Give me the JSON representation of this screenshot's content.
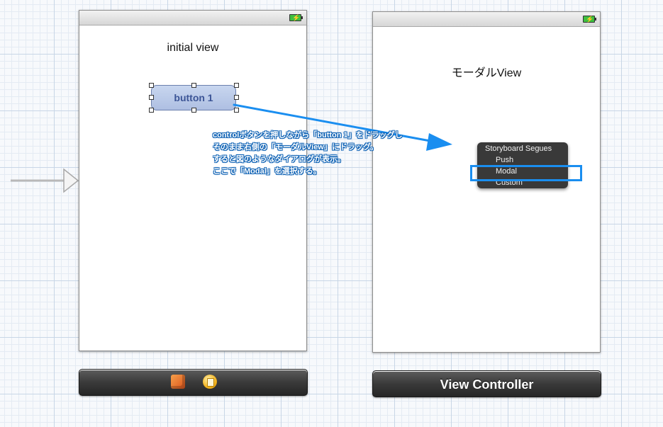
{
  "scenes": {
    "initial": {
      "title": "initial view",
      "button_label": "button 1"
    },
    "modal": {
      "title": "モーダルView"
    }
  },
  "docks": {
    "initial": {
      "icons": [
        "first-responder-cube-icon",
        "view-controller-icon"
      ]
    },
    "modal": {
      "label": "View Controller"
    }
  },
  "annotation": {
    "lines": [
      "controlボタンを押しながら「button 1」をドラッグし",
      "そのまま右側の「モーダルView」にドラッグ。",
      "すると図のようなダイアログが表示。",
      "ここで「Modal」を選択する。"
    ]
  },
  "segue_menu": {
    "header": "Storyboard Segues",
    "items": [
      "Push",
      "Modal",
      "Custom"
    ],
    "highlighted": "Modal"
  },
  "colors": {
    "arrow": "#1a8ef0",
    "highlight": "#1a8ef0",
    "button_fill": "#b4c5e8",
    "button_text": "#3c5596"
  }
}
